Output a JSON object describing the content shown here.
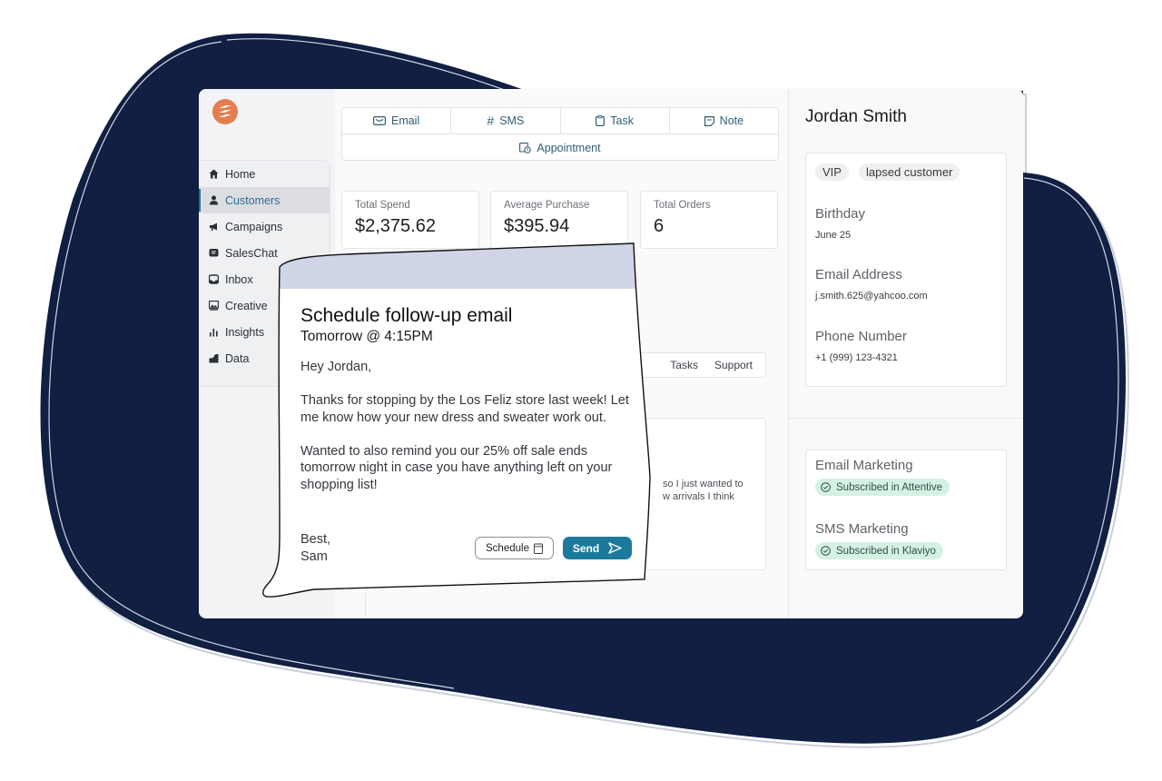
{
  "colors": {
    "blob": "#101f42",
    "brand_logo": "#e57d4f",
    "accent": "#2a6f97",
    "send_button": "#1b7a9c",
    "popup_header": "#cfd5e6",
    "subscribed_badge": "#d4f1e4"
  },
  "sidebar": {
    "logo_icon": "brand-logo-icon",
    "items": [
      {
        "label": "Home",
        "icon": "home-icon",
        "active": false
      },
      {
        "label": "Customers",
        "icon": "user-icon",
        "active": true
      },
      {
        "label": "Campaigns",
        "icon": "megaphone-icon",
        "active": false
      },
      {
        "label": "SalesChat",
        "icon": "chat-icon",
        "active": false
      },
      {
        "label": "Inbox",
        "icon": "inbox-icon",
        "active": false
      },
      {
        "label": "Creative",
        "icon": "image-icon",
        "active": false
      },
      {
        "label": "Insights",
        "icon": "bar-chart-icon",
        "active": false
      },
      {
        "label": "Data",
        "icon": "data-icon",
        "active": false
      }
    ]
  },
  "actions": {
    "email": "Email",
    "sms": "SMS",
    "task": "Task",
    "note": "Note",
    "appointment": "Appointment"
  },
  "stats": [
    {
      "label": "Total Spend",
      "value": "$2,375.62"
    },
    {
      "label": "Average Purchase",
      "value": "$395.94"
    },
    {
      "label": "Total Orders",
      "value": "6"
    }
  ],
  "tabs": {
    "tasks": "Tasks",
    "support": "Support"
  },
  "note_snippet": {
    "line1": "so I just wanted to",
    "line2": "w arrivals I think"
  },
  "customer": {
    "name": "Jordan Smith",
    "tags": [
      "VIP",
      "lapsed customer"
    ],
    "birthday_label": "Birthday",
    "birthday": "June 25",
    "email_label": "Email Address",
    "email": "j.smith.625@yahcoo.com",
    "phone_label": "Phone Number",
    "phone": "+1 (999) 123-4321"
  },
  "marketing": {
    "email_label": "Email Marketing",
    "email_status": "Subscribed in Attentive",
    "sms_label": "SMS Marketing",
    "sms_status": "Subscribed in Klaviyo"
  },
  "popup": {
    "title": "Schedule follow-up email",
    "subtitle": "Tomorrow @ 4:15PM",
    "greeting": "Hey Jordan,",
    "paragraph1": "Thanks for stopping by the Los Feliz store last week! Let me know how your new dress and sweater work out.",
    "paragraph2": "Wanted to also remind you our 25% off sale ends tomorrow night in case you have anything left on your shopping list!",
    "signoff": "Best,",
    "signature": "Sam",
    "schedule_label": "Schedule",
    "send_label": "Send"
  }
}
